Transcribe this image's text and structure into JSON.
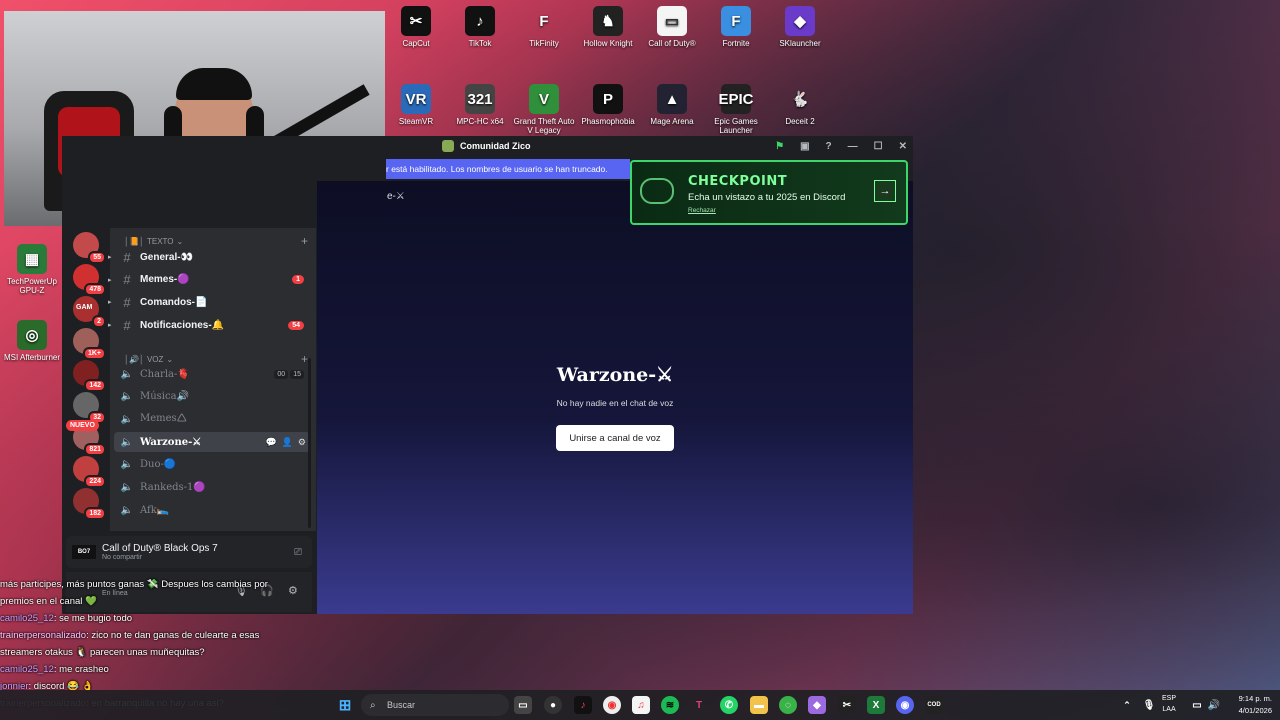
{
  "desktop_icons": [
    {
      "label": "CapCut",
      "glyph": "✂",
      "bg": "#111"
    },
    {
      "label": "TikTok",
      "glyph": "♪",
      "bg": "#111"
    },
    {
      "label": "TikFinity",
      "glyph": "F",
      "bg": "transparent"
    },
    {
      "label": "Hollow Knight",
      "glyph": "♞",
      "bg": "#222"
    },
    {
      "label": "Call of Duty®",
      "glyph": "▭",
      "bg": "#f5f5f5"
    },
    {
      "label": "Fortnite",
      "glyph": "F",
      "bg": "#3a8fe0"
    },
    {
      "label": "SKlauncher",
      "glyph": "◆",
      "bg": "#6a3acb"
    },
    {
      "label": "SteamVR",
      "glyph": "VR",
      "bg": "#2a6ab8"
    },
    {
      "label": "MPC-HC x64",
      "glyph": "321",
      "bg": "#444"
    },
    {
      "label": "Grand Theft Auto V Legacy",
      "glyph": "V",
      "bg": "#2f8f3a"
    },
    {
      "label": "Phasmophobia",
      "glyph": "P",
      "bg": "#111"
    },
    {
      "label": "Mage Arena",
      "glyph": "▲",
      "bg": "#223"
    },
    {
      "label": "Epic Games Launcher",
      "glyph": "EPIC",
      "bg": "#222"
    },
    {
      "label": "Deceit 2",
      "glyph": "🐇",
      "bg": "transparent"
    },
    {
      "label": "TechPowerUp GPU-Z",
      "glyph": "▦",
      "bg": "#2a7a3a"
    },
    {
      "label": "MSI Afterburner",
      "glyph": "◎",
      "bg": "#2a6a2a"
    }
  ],
  "discord": {
    "window_title": "Comunidad Zico",
    "banner_text": "r está habilitado. Los nombres de usuario se han truncado.",
    "channel_header": "e-⚔",
    "servers": [
      {
        "badge": "55",
        "color": "#c24a4a"
      },
      {
        "badge": "478",
        "color": "#d03030"
      },
      {
        "badge": "2",
        "color": "#aa3030",
        "label": "GAM"
      },
      {
        "badge": "1K+",
        "color": "#a0605a"
      },
      {
        "badge": "142",
        "color": "#802020"
      },
      {
        "badge": "32",
        "color": "#666"
      },
      {
        "badge": "821",
        "color": "#a06060"
      },
      {
        "badge": "224",
        "color": "#c04040"
      },
      {
        "badge": "182",
        "color": "#903030"
      }
    ],
    "nuevo_label": "NUEVO",
    "categories": {
      "text": "TEXTO",
      "voice": "VOZ"
    },
    "text_channels": [
      {
        "name": "General-👀",
        "badge": ""
      },
      {
        "name": "Memes-🟣",
        "badge": "1"
      },
      {
        "name": "Comandos-📄",
        "badge": ""
      },
      {
        "name": "Notificaciones-🔔",
        "badge": "54"
      }
    ],
    "voice_channels": [
      {
        "name": "Charla-🫀",
        "limits": [
          "00",
          "15"
        ]
      },
      {
        "name": "Música🔊"
      },
      {
        "name": "Memes🛆"
      },
      {
        "name": "Warzone-⚔",
        "active": true
      },
      {
        "name": "Duo-🔵"
      },
      {
        "name": "Rankeds-1🟣"
      },
      {
        "name": "Afk🛌"
      }
    ],
    "activity": {
      "logo": "BO7",
      "game": "Call of Duty® Black Ops 7",
      "status": "No compartir"
    },
    "userbar": {
      "status": "En línea"
    },
    "voice_view": {
      "title": "Warzone-⚔",
      "subtitle": "No hay nadie en el chat de voz",
      "join_label": "Unirse a canal de voz"
    },
    "checkpoint": {
      "title": "CHECKPOINT",
      "subtitle": "Echa un vistazo a tu 2025 en Discord",
      "dismiss": "Rechazar"
    }
  },
  "chat": [
    {
      "user": "",
      "text": "más participes, más puntos ganas 💸 Despues los cambias por"
    },
    {
      "user": "",
      "text": "premios en el canal 💚"
    },
    {
      "user": "camilo25_12",
      "text": ": se me bugio todo"
    },
    {
      "user": "trainerpersonalizado",
      "text": ": zico no te dan ganas de culearte a esas"
    },
    {
      "user": "",
      "text": "streamers otakus 🐧 parecen unas muñequitas?"
    },
    {
      "user": "camilo25_12",
      "text": ": me crasheo"
    },
    {
      "user": "jonnier",
      "text": ": discord 😂 👌"
    },
    {
      "user": "trainerpersonalizado",
      "text": ": en barranquilla no hay una asi?"
    }
  ],
  "taskbar": {
    "search_placeholder": "Buscar",
    "lang_top": "ESP",
    "lang_bottom": "LAA",
    "time": "9:14 p. m.",
    "date": "4/01/2026"
  }
}
